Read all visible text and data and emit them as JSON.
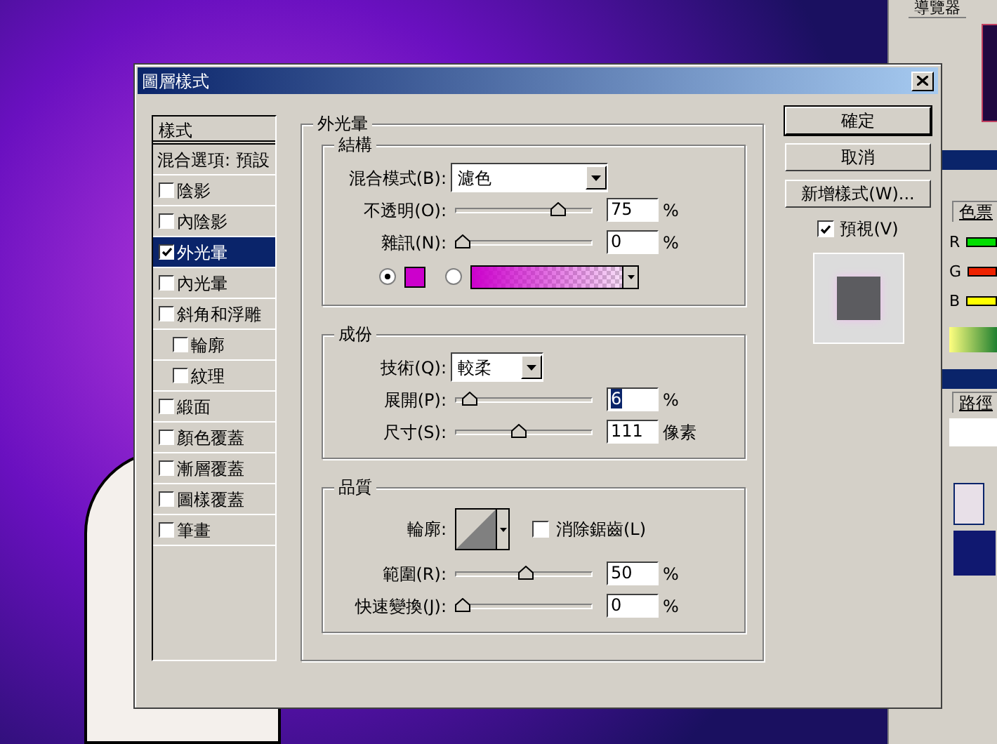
{
  "side_panels": {
    "navigator_tab": "導覽器",
    "swatches_tab": "色票",
    "paths_tab": "路徑",
    "channels": [
      {
        "label": "R",
        "color": "#00dd00"
      },
      {
        "label": "G",
        "color": "#ee2200"
      },
      {
        "label": "B",
        "color": "#ffff00"
      }
    ]
  },
  "dialog": {
    "title": "圖層樣式",
    "style_list": {
      "header": "樣式",
      "items": [
        {
          "label": "混合選項: 預設",
          "kind": "plain",
          "selected": false
        },
        {
          "label": "陰影",
          "kind": "checkbox",
          "checked": false,
          "selected": false
        },
        {
          "label": "內陰影",
          "kind": "checkbox",
          "checked": false,
          "selected": false
        },
        {
          "label": "外光暈",
          "kind": "checkbox",
          "checked": true,
          "selected": true
        },
        {
          "label": "內光暈",
          "kind": "checkbox",
          "checked": false,
          "selected": false
        },
        {
          "label": "斜角和浮雕",
          "kind": "checkbox",
          "checked": false,
          "selected": false,
          "children": [
            {
              "label": "輪廓",
              "kind": "checkbox",
              "checked": false,
              "selected": false
            },
            {
              "label": "紋理",
              "kind": "checkbox",
              "checked": false,
              "selected": false
            }
          ]
        },
        {
          "label": "緞面",
          "kind": "checkbox",
          "checked": false,
          "selected": false
        },
        {
          "label": "顏色覆蓋",
          "kind": "checkbox",
          "checked": false,
          "selected": false
        },
        {
          "label": "漸層覆蓋",
          "kind": "checkbox",
          "checked": false,
          "selected": false
        },
        {
          "label": "圖樣覆蓋",
          "kind": "checkbox",
          "checked": false,
          "selected": false
        },
        {
          "label": "筆畫",
          "kind": "checkbox",
          "checked": false,
          "selected": false
        }
      ]
    },
    "panel": {
      "title": "外光暈",
      "sections": [
        {
          "title": "結構",
          "rows": [
            {
              "kind": "dropdown",
              "label": "混合模式(B):",
              "value": "濾色"
            },
            {
              "kind": "slider",
              "label": "不透明(O):",
              "level": 0.75,
              "value": "75",
              "unit": "%"
            },
            {
              "kind": "slider",
              "label": "雜訊(N):",
              "level": 0,
              "value": "0",
              "unit": "%"
            },
            {
              "kind": "fill",
              "options": [
                {
                  "kind": "solid",
                  "selected": true,
                  "color": "#cc00cc"
                },
                {
                  "kind": "gradient",
                  "selected": false,
                  "color": "#cc00cc"
                }
              ]
            }
          ]
        },
        {
          "title": "成份",
          "rows": [
            {
              "kind": "dropdown",
              "label": "技術(Q):",
              "value": "較柔"
            },
            {
              "kind": "slider",
              "label": "展開(P):",
              "level": 0.06,
              "value": "6",
              "unit": "%",
              "text_selected": true
            },
            {
              "kind": "slider",
              "label": "尺寸(S):",
              "level": 0.44,
              "value": "111",
              "unit": "像素"
            }
          ]
        },
        {
          "title": "品質",
          "rows": [
            {
              "kind": "contour",
              "label": "輪廓:",
              "checkbox_label": "消除鋸齒(L)",
              "checked": false
            },
            {
              "kind": "slider",
              "label": "範圍(R):",
              "level": 0.5,
              "value": "50",
              "unit": "%"
            },
            {
              "kind": "slider",
              "label": "快速變換(J):",
              "level": 0,
              "value": "0",
              "unit": "%"
            }
          ]
        }
      ]
    },
    "buttons": [
      {
        "label": "確定",
        "default": true
      },
      {
        "label": "取消",
        "default": false
      },
      {
        "label": "新增樣式(W)...",
        "default": false
      }
    ],
    "preview": {
      "label": "預視(V)",
      "checked": true
    }
  }
}
